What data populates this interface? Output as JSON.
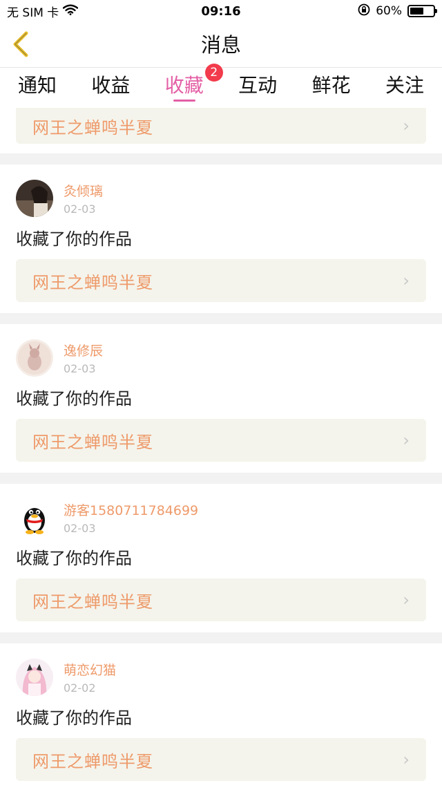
{
  "status_bar": {
    "carrier": "无 SIM 卡",
    "time": "09:16",
    "battery": "60%",
    "battery_level": 0.6
  },
  "nav": {
    "title": "消息"
  },
  "tabs": [
    {
      "label": "通知"
    },
    {
      "label": "收益"
    },
    {
      "label": "收藏",
      "badge": "2",
      "active": true
    },
    {
      "label": "互动"
    },
    {
      "label": "鲜花"
    },
    {
      "label": "关注"
    }
  ],
  "items": [
    {
      "work_title": "网王之蝉鸣半夏"
    },
    {
      "username": "灸倾璃",
      "date": "02-03",
      "action": "收藏了你的作品",
      "work_title": "网王之蝉鸣半夏"
    },
    {
      "username": "逸修辰",
      "date": "02-03",
      "action": "收藏了你的作品",
      "work_title": "网王之蝉鸣半夏"
    },
    {
      "username": "游客1580711784699",
      "date": "02-03",
      "action": "收藏了你的作品",
      "work_title": "网王之蝉鸣半夏"
    },
    {
      "username": "萌恋幻猫",
      "date": "02-02",
      "action": "收藏了你的作品",
      "work_title": "网王之蝉鸣半夏"
    }
  ],
  "colors": {
    "accent": "#e45fa5",
    "badge": "#f23b4c",
    "work_title": "#ee9a6a",
    "work_box_bg": "#f4f4ec",
    "back_arrow": "#e9bf2e"
  }
}
